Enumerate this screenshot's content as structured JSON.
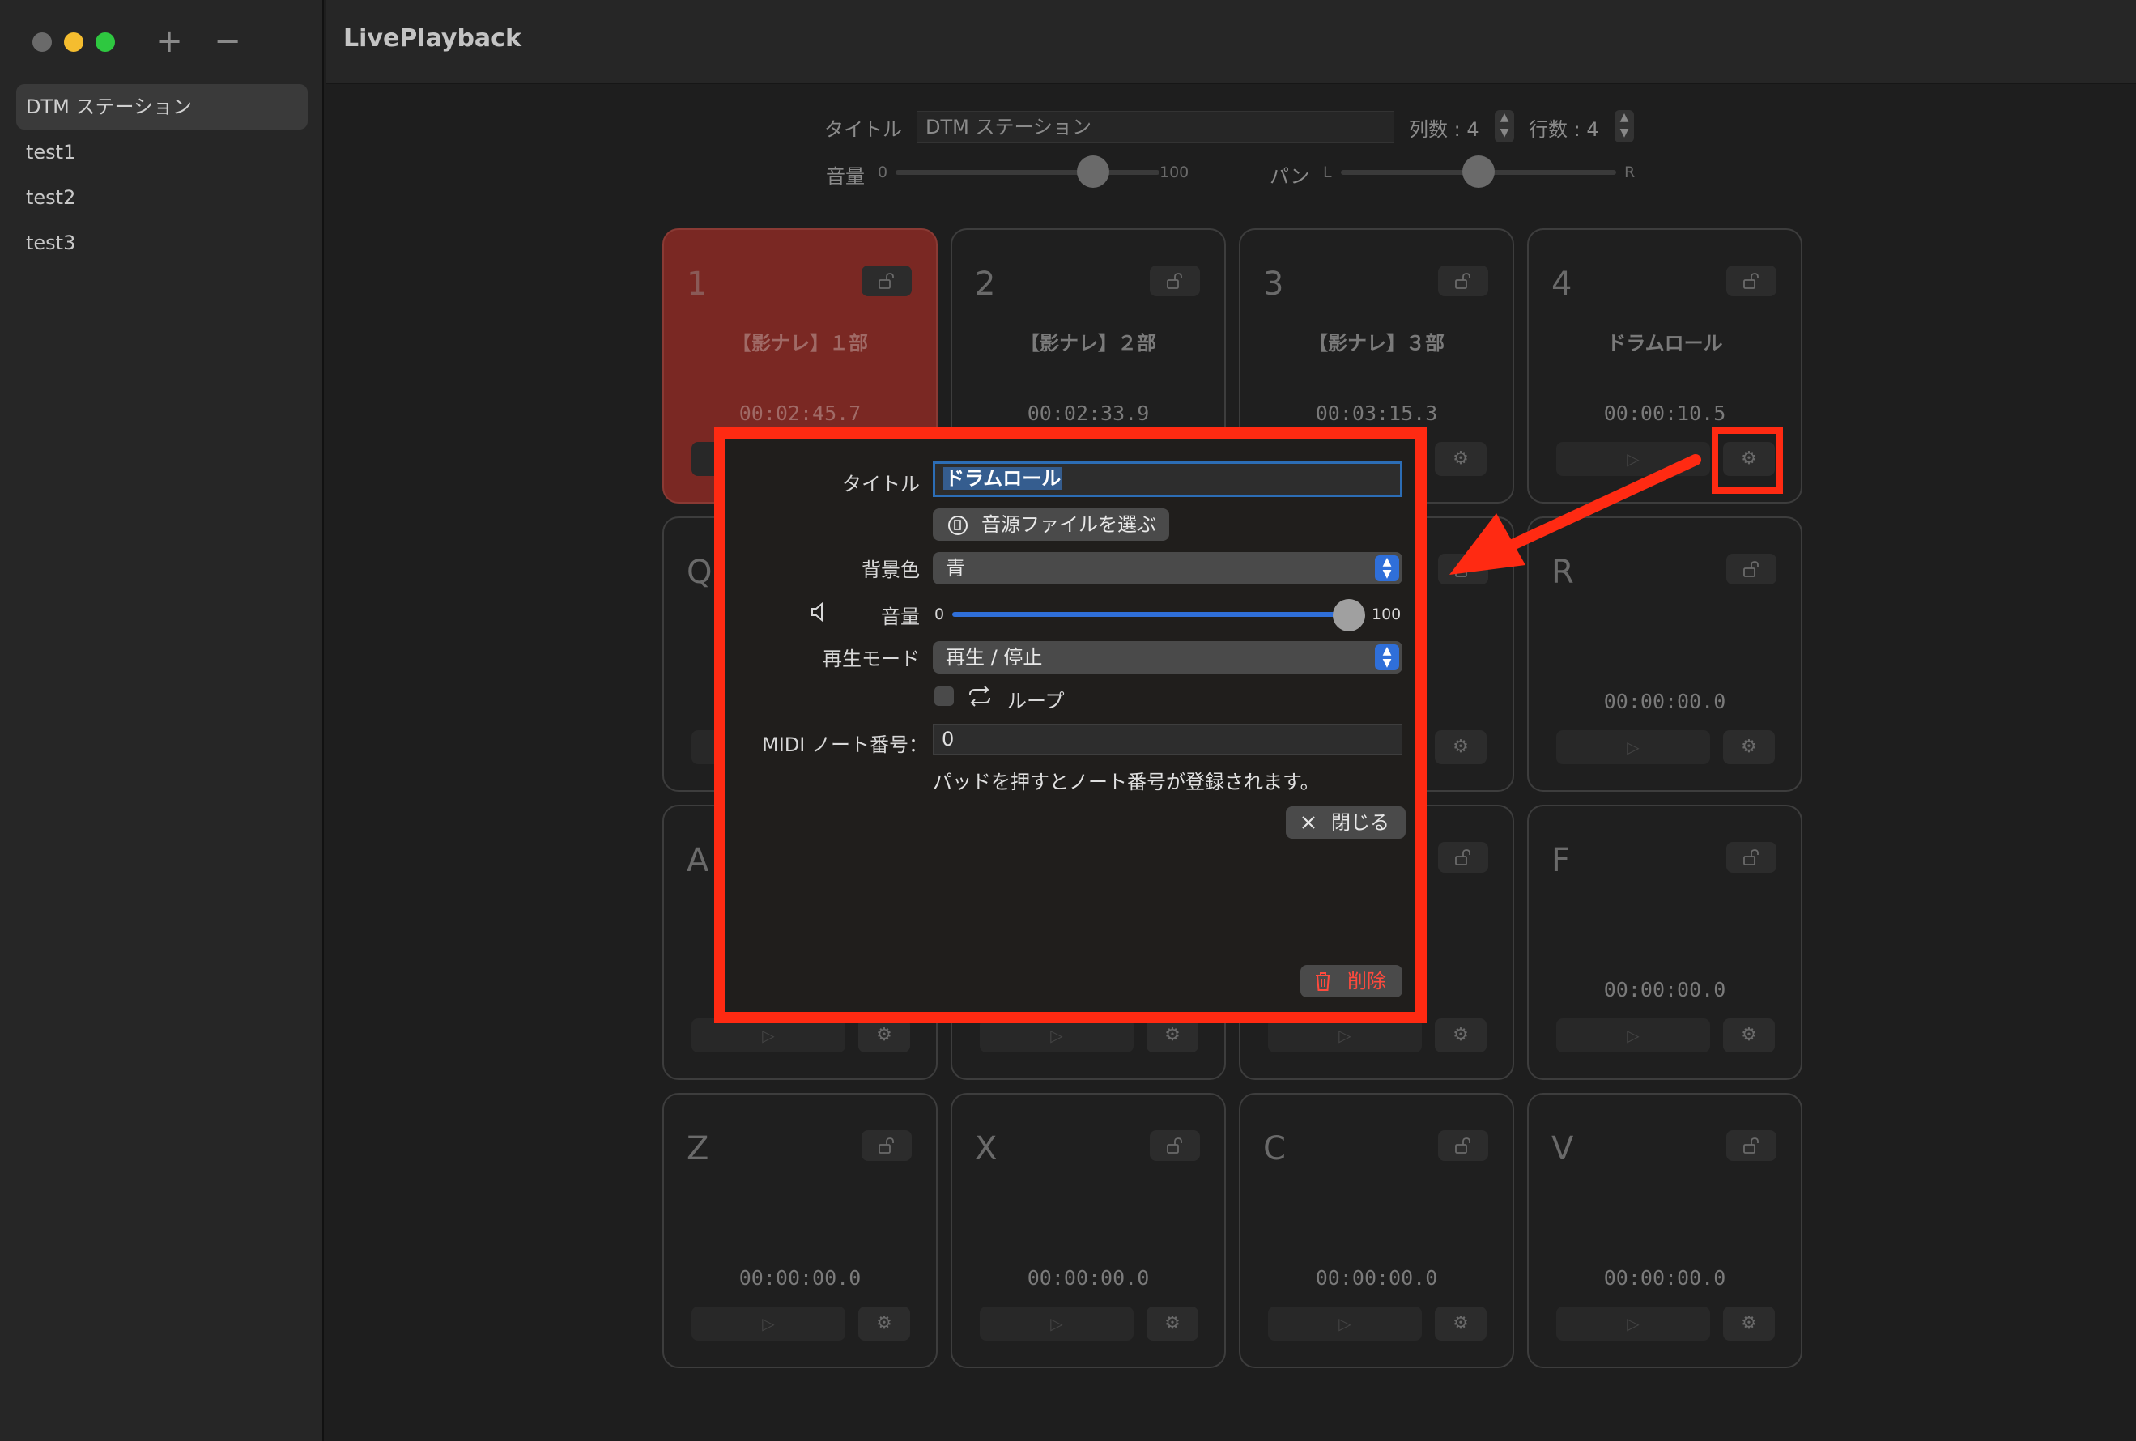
{
  "app": {
    "title": "LivePlayback"
  },
  "sidebar": {
    "add_label": "+",
    "remove_label": "−",
    "items": [
      {
        "label": "DTM ステーション"
      },
      {
        "label": "test1"
      },
      {
        "label": "test2"
      },
      {
        "label": "test3"
      }
    ]
  },
  "controls": {
    "title_label": "タイトル",
    "title_value": "DTM ステーション",
    "cols_label": "列数 : 4",
    "rows_label": "行数 : 4",
    "volume_label": "音量",
    "volume_min": "0",
    "volume_max": "100",
    "pan_label": "パン",
    "pan_min": "L",
    "pan_max": "R"
  },
  "pads": [
    {
      "key": "1",
      "name": "【影ナレ】１部",
      "time": "00:02:45.7"
    },
    {
      "key": "2",
      "name": "【影ナレ】２部",
      "time": "00:02:33.9"
    },
    {
      "key": "3",
      "name": "【影ナレ】３部",
      "time": "00:03:15.3"
    },
    {
      "key": "4",
      "name": "ドラムロール",
      "time": "00:00:10.5"
    },
    {
      "key": "Q",
      "name": "",
      "time": ""
    },
    {
      "key": "",
      "name": "",
      "time": ""
    },
    {
      "key": "",
      "name": "",
      "time": ""
    },
    {
      "key": "R",
      "name": "",
      "time": "00:00:00.0"
    },
    {
      "key": "A",
      "name": "",
      "time": ""
    },
    {
      "key": "",
      "name": "",
      "time": ""
    },
    {
      "key": "",
      "name": "",
      "time": ""
    },
    {
      "key": "F",
      "name": "",
      "time": "00:00:00.0"
    },
    {
      "key": "Z",
      "name": "",
      "time": "00:00:00.0"
    },
    {
      "key": "X",
      "name": "",
      "time": "00:00:00.0"
    },
    {
      "key": "C",
      "name": "",
      "time": "00:00:00.0"
    },
    {
      "key": "V",
      "name": "",
      "time": "00:00:00.0"
    }
  ],
  "play_glyph": "▷",
  "gear_glyph": "⚙",
  "dialog": {
    "title_label": "タイトル",
    "title_value": "ドラムロール",
    "file_button": "音源ファイルを選ぶ",
    "bg_label": "背景色",
    "bg_value": "青",
    "volume_label": "音量",
    "volume_min": "0",
    "volume_max": "100",
    "volume_value": 100,
    "mode_label": "再生モード",
    "mode_value": "再生 / 停止",
    "loop_label": "ループ",
    "loop_checked": false,
    "midi_label": "MIDI ノート番号：",
    "midi_value": "0",
    "hint": "パッドを押すとノート番号が登録されます。",
    "close_button": "閉じる",
    "delete_button": "削除"
  },
  "colors": {
    "accent": "#2f6fd9",
    "active_pad": "#7a2823",
    "highlight": "#ff2a12",
    "delete": "#ff4a3d"
  }
}
